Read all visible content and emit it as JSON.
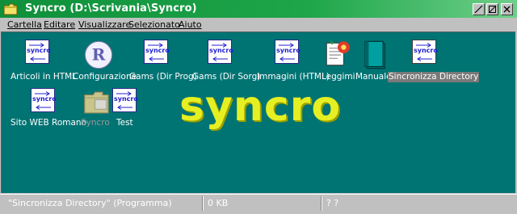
{
  "window": {
    "title": "Syncro (D:\\Scrivania\\Syncro)"
  },
  "menubar": {
    "items": [
      {
        "label": "Cartella"
      },
      {
        "label": "Editare"
      },
      {
        "label": "Visualizzare"
      },
      {
        "label": "Selezionato"
      },
      {
        "label": "Aiuto"
      }
    ]
  },
  "content": {
    "background": "#007373",
    "watermark": "syncro",
    "icons": [
      {
        "label": "Articoli in HTML",
        "icon": "syncro-icon",
        "box_text": "syncro"
      },
      {
        "label": "Configurazione",
        "icon": "app-r-icon"
      },
      {
        "label": "Gams (Dir Prog)",
        "icon": "syncro-icon",
        "box_text": "syncro"
      },
      {
        "label": "Gams (Dir Sorg)",
        "icon": "syncro-icon",
        "box_text": "syncro"
      },
      {
        "label": "Immagini (HTML)",
        "icon": "syncro-icon",
        "box_text": "syncro"
      },
      {
        "label": "Leggimi",
        "icon": "readme-icon"
      },
      {
        "label": "Manuale",
        "icon": "book-icon"
      },
      {
        "label": "Sincronizza Directory",
        "icon": "syncro-icon",
        "box_text": "syncro",
        "selected": true
      },
      {
        "label": "Sito WEB Romano",
        "icon": "syncro-icon",
        "box_text": "syncro"
      },
      {
        "label": "Syncro",
        "icon": "folder-icon",
        "dim": true
      },
      {
        "label": "Test",
        "icon": "syncro-icon",
        "box_text": "syncro"
      }
    ]
  },
  "statusbar": {
    "item": "\"Sincronizza Directory\" (Programma)",
    "size": "0 KB",
    "extra": "? ?"
  }
}
